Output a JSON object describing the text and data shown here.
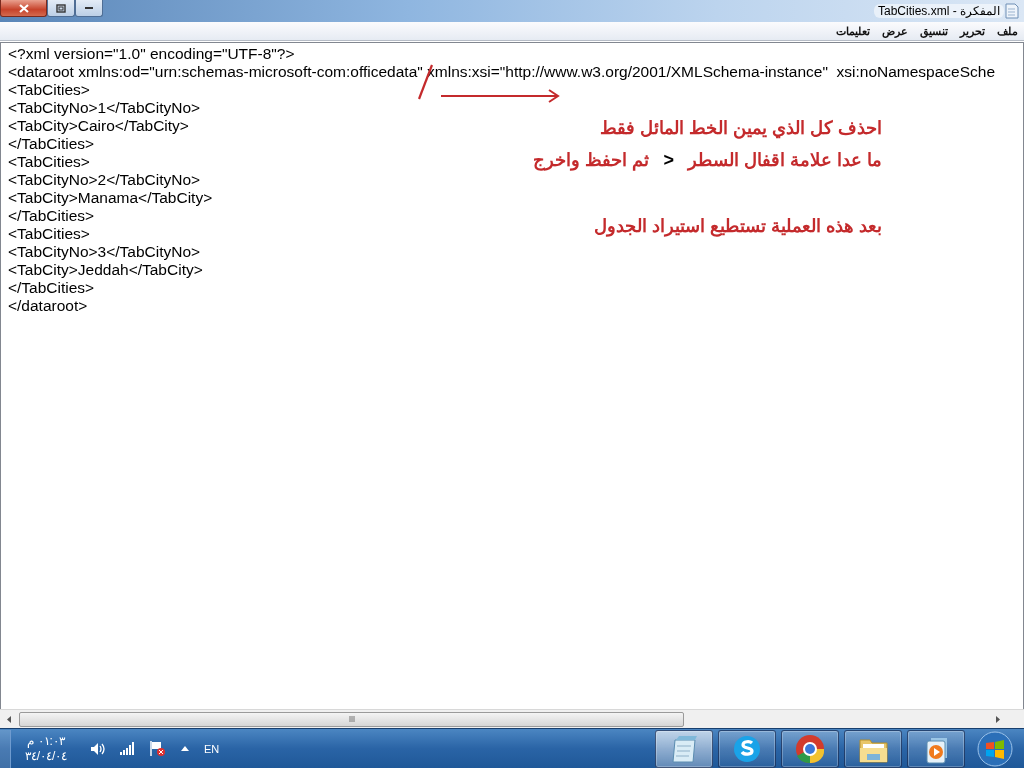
{
  "window": {
    "title": "TabCities.xml - المفكرة"
  },
  "menu": [
    "ملف",
    "تحرير",
    "تنسيق",
    "عرض",
    "تعليمات"
  ],
  "editor": {
    "lines": [
      "<?xml version=\"1.0\" encoding=\"UTF-8\"?>",
      "<dataroot xmlns:od=\"urn:schemas-microsoft-com:officedata\" xmlns:xsi=\"http://www.w3.org/2001/XMLSchema-instance\"  xsi:noNamespaceSche",
      "<TabCities>",
      "<TabCityNo>1</TabCityNo>",
      "<TabCity>Cairo</TabCity>",
      "</TabCities>",
      "<TabCities>",
      "<TabCityNo>2</TabCityNo>",
      "<TabCity>Manama</TabCity>",
      "</TabCities>",
      "<TabCities>",
      "<TabCityNo>3</TabCityNo>",
      "<TabCity>Jeddah</TabCity>",
      "</TabCities>",
      "</dataroot>"
    ]
  },
  "annotations": [
    {
      "parts": [
        {
          "kind": "text",
          "text": "احذف كل الذي يمين الخط المائل فقط"
        }
      ]
    },
    {
      "parts": [
        {
          "kind": "text",
          "text": "ما عدا علامة اقفال السطر"
        },
        {
          "kind": "symbol",
          "text": "<"
        },
        {
          "kind": "text",
          "text": "ثم احفظ واخرج"
        }
      ]
    },
    {
      "parts": [
        {
          "kind": "text",
          "text": "بعد هذه العملية تستطيع استيراد الجدول"
        }
      ]
    }
  ],
  "taskbar": {
    "apps": [
      {
        "kind": "notepad",
        "selected": true
      },
      {
        "kind": "skype",
        "selected": false
      },
      {
        "kind": "chrome",
        "selected": false
      },
      {
        "kind": "folder",
        "selected": false
      },
      {
        "kind": "media",
        "selected": false
      }
    ],
    "language": "EN",
    "time": "٠١:٠٣ م",
    "date": "٣٤/٠٤/٠٤"
  }
}
